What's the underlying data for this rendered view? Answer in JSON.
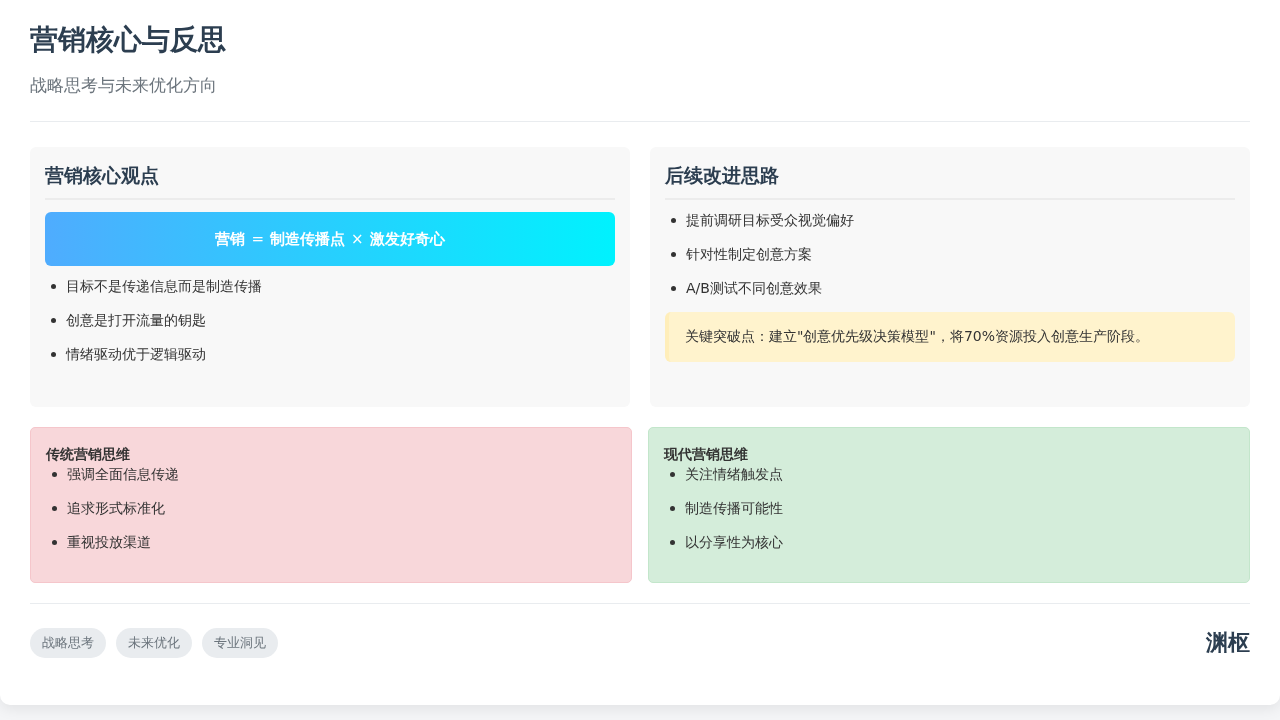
{
  "header": {
    "title": "营销核心与反思",
    "subtitle": "战略思考与未来优化方向"
  },
  "panels": [
    {
      "title": "营销核心观点",
      "formula": "**营销** = **制造传播点** × **激发好奇心**",
      "items": [
        "目标不是传递信息而是制造传播",
        "创意是打开流量的钥匙",
        "情绪驱动优于逻辑驱动"
      ]
    },
    {
      "title": "后续改进思路",
      "items": [
        "提前调研目标受众视觉偏好",
        "针对性制定创意方案",
        "A/B测试不同创意效果"
      ],
      "highlight": "关键突破点：建立\"创意优先级决策模型\"，将70%资源投入创意生产阶段。"
    }
  ],
  "comparison": [
    {
      "kind": "traditional",
      "title": "传统营销思维",
      "items": [
        "强调全面信息传递",
        "追求形式标准化",
        "重视投放渠道"
      ]
    },
    {
      "kind": "modern",
      "title": "现代营销思维",
      "items": [
        "关注情绪触发点",
        "制造传播可能性",
        "以分享性为核心"
      ]
    }
  ],
  "footer": {
    "tags": [
      "战略思考",
      "未来优化",
      "专业洞见"
    ],
    "brand": "渊枢"
  }
}
